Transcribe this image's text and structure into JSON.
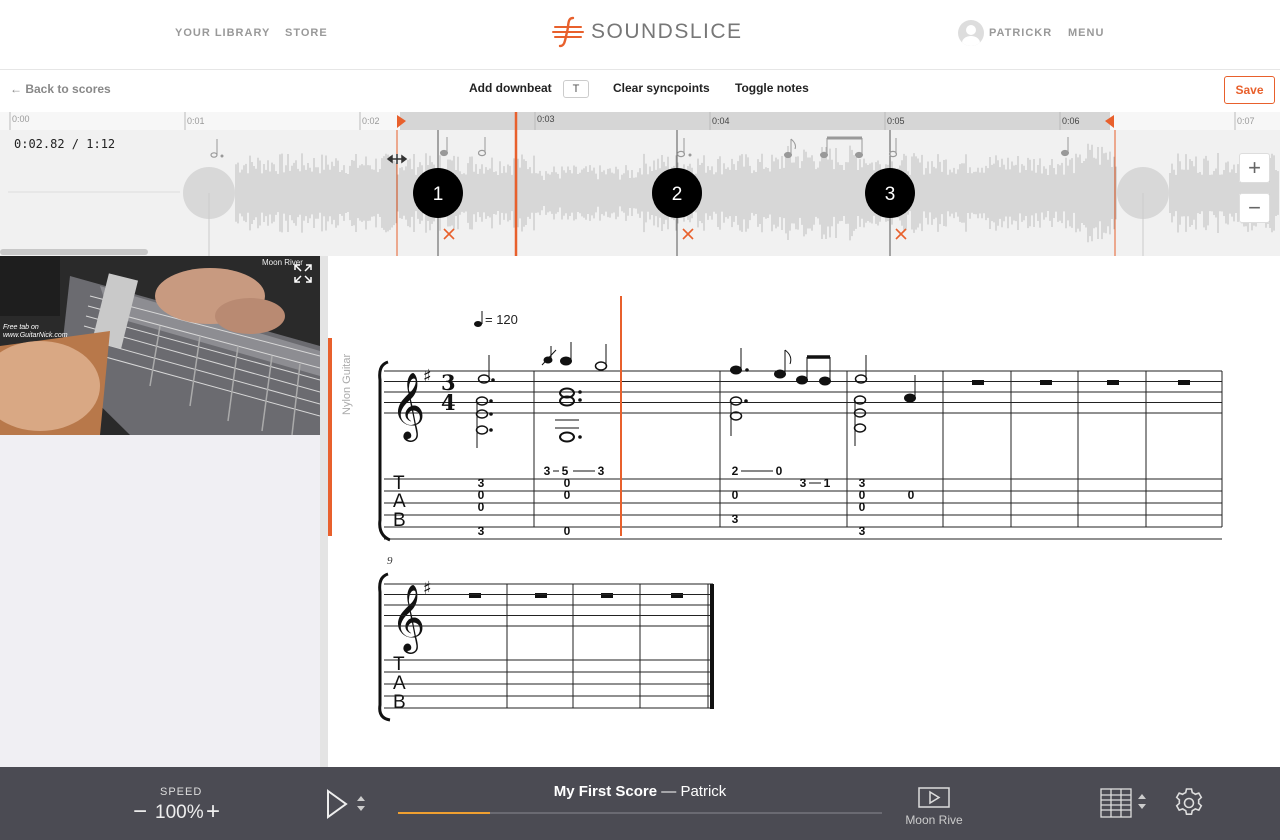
{
  "nav": {
    "library": "YOUR LIBRARY",
    "store": "STORE",
    "logo": "SOUNDSLICE",
    "username": "PATRICKR",
    "menu": "MENU"
  },
  "toolbar": {
    "back": "← Back to scores",
    "add_downbeat": "Add downbeat",
    "add_downbeat_key": "T",
    "clear_syncpoints": "Clear syncpoints",
    "toggle_notes": "Toggle notes",
    "save": "Save"
  },
  "timeline": {
    "readout": "0:02.82 / 1:12",
    "ticks": [
      "0:00",
      "0:01",
      "0:02",
      "0:03",
      "0:04",
      "0:05",
      "0:06",
      "0:07"
    ],
    "beats": [
      "1",
      "2",
      "3"
    ],
    "zoom_in": "+",
    "zoom_out": "−"
  },
  "video": {
    "title": "Moon River",
    "watermark_line1": "Free tab on",
    "watermark_line2": "www.GuitarNick.com"
  },
  "score": {
    "instrument": "Nylon Guitar",
    "tempo": "= 120",
    "time_signature_top": "3",
    "time_signature_bottom": "4",
    "second_system_measure_number": "9",
    "tab_letters": [
      "T",
      "A",
      "B"
    ],
    "tab_numbers": [
      {
        "m": 1,
        "s": 1,
        "v": "3"
      },
      {
        "m": 1,
        "s": 2,
        "v": "0"
      },
      {
        "m": 1,
        "s": 3,
        "v": "0"
      },
      {
        "m": 1,
        "s": 5,
        "v": "3"
      },
      {
        "m": 2,
        "s": 0,
        "v": "3"
      },
      {
        "m": 2,
        "s": 0,
        "v": "5"
      },
      {
        "m": 2,
        "s": 0,
        "v": "3"
      },
      {
        "m": 2,
        "s": 1,
        "v": "0"
      },
      {
        "m": 2,
        "s": 2,
        "v": "0"
      },
      {
        "m": 2,
        "s": 5,
        "v": "0"
      },
      {
        "m": 3,
        "s": 0,
        "v": "2"
      },
      {
        "m": 3,
        "s": 0,
        "v": "0"
      },
      {
        "m": 3,
        "s": 1,
        "v": "3"
      },
      {
        "m": 3,
        "s": 1,
        "v": "1"
      },
      {
        "m": 3,
        "s": 2,
        "v": "0"
      },
      {
        "m": 3,
        "s": 4,
        "v": "3"
      },
      {
        "m": 4,
        "s": 1,
        "v": "3"
      },
      {
        "m": 4,
        "s": 2,
        "v": "0"
      },
      {
        "m": 4,
        "s": 2,
        "v": "0"
      },
      {
        "m": 4,
        "s": 3,
        "v": "0"
      },
      {
        "m": 4,
        "s": 5,
        "v": "3"
      }
    ]
  },
  "player": {
    "speed_label": "SPEED",
    "speed_value": "100%",
    "title": "My First Score",
    "separator": " — ",
    "artist": "Patrick",
    "progress": 0.19,
    "video_label": "Moon Rive"
  },
  "colors": {
    "accent": "#e8602c",
    "progress": "#f0a030",
    "bottom_bar": "#4b4b53"
  }
}
